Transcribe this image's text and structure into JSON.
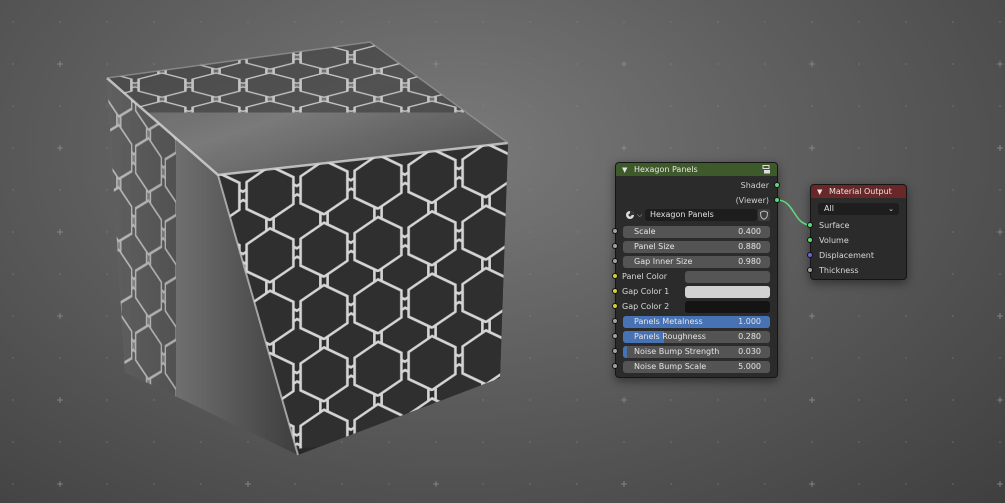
{
  "colors": {
    "group_header": "#3f5a2a",
    "output_header": "#6a2727",
    "accent_blue": "#4772b3",
    "panel_color": "#555555",
    "gap_color_1": "#d2d2d2",
    "gap_color_2": "#141414"
  },
  "group_node": {
    "title": "Hexagon Panels",
    "header_icon": "node-tree-icon",
    "outputs": [
      "Shader",
      "(Viewer)"
    ],
    "datablock": {
      "icon": "node-group-icon",
      "name": "Hexagon Panels",
      "fake_user_icon": "shield-icon"
    },
    "inputs": [
      {
        "label": "Scale",
        "value": "0.400",
        "fill": 0
      },
      {
        "label": "Panel Size",
        "value": "0.880",
        "fill": 0
      },
      {
        "label": "Gap Inner Size",
        "value": "0.980",
        "fill": 0
      }
    ],
    "color_inputs": [
      {
        "label": "Panel Color"
      },
      {
        "label": "Gap Color 1"
      },
      {
        "label": "Gap Color 2"
      }
    ],
    "slider_inputs": [
      {
        "label": "Panels Metalness",
        "value": "1.000",
        "fill": 1.0
      },
      {
        "label": "Panels Roughness",
        "value": "0.280",
        "fill": 0.28
      },
      {
        "label": "Noise Bump Strength",
        "value": "0.030",
        "fill": 0.03
      },
      {
        "label": "Noise Bump Scale",
        "value": "5.000",
        "fill": 0
      }
    ]
  },
  "output_node": {
    "title": "Material Output",
    "target": "All",
    "inputs": [
      "Surface",
      "Volume",
      "Displacement",
      "Thickness"
    ]
  }
}
